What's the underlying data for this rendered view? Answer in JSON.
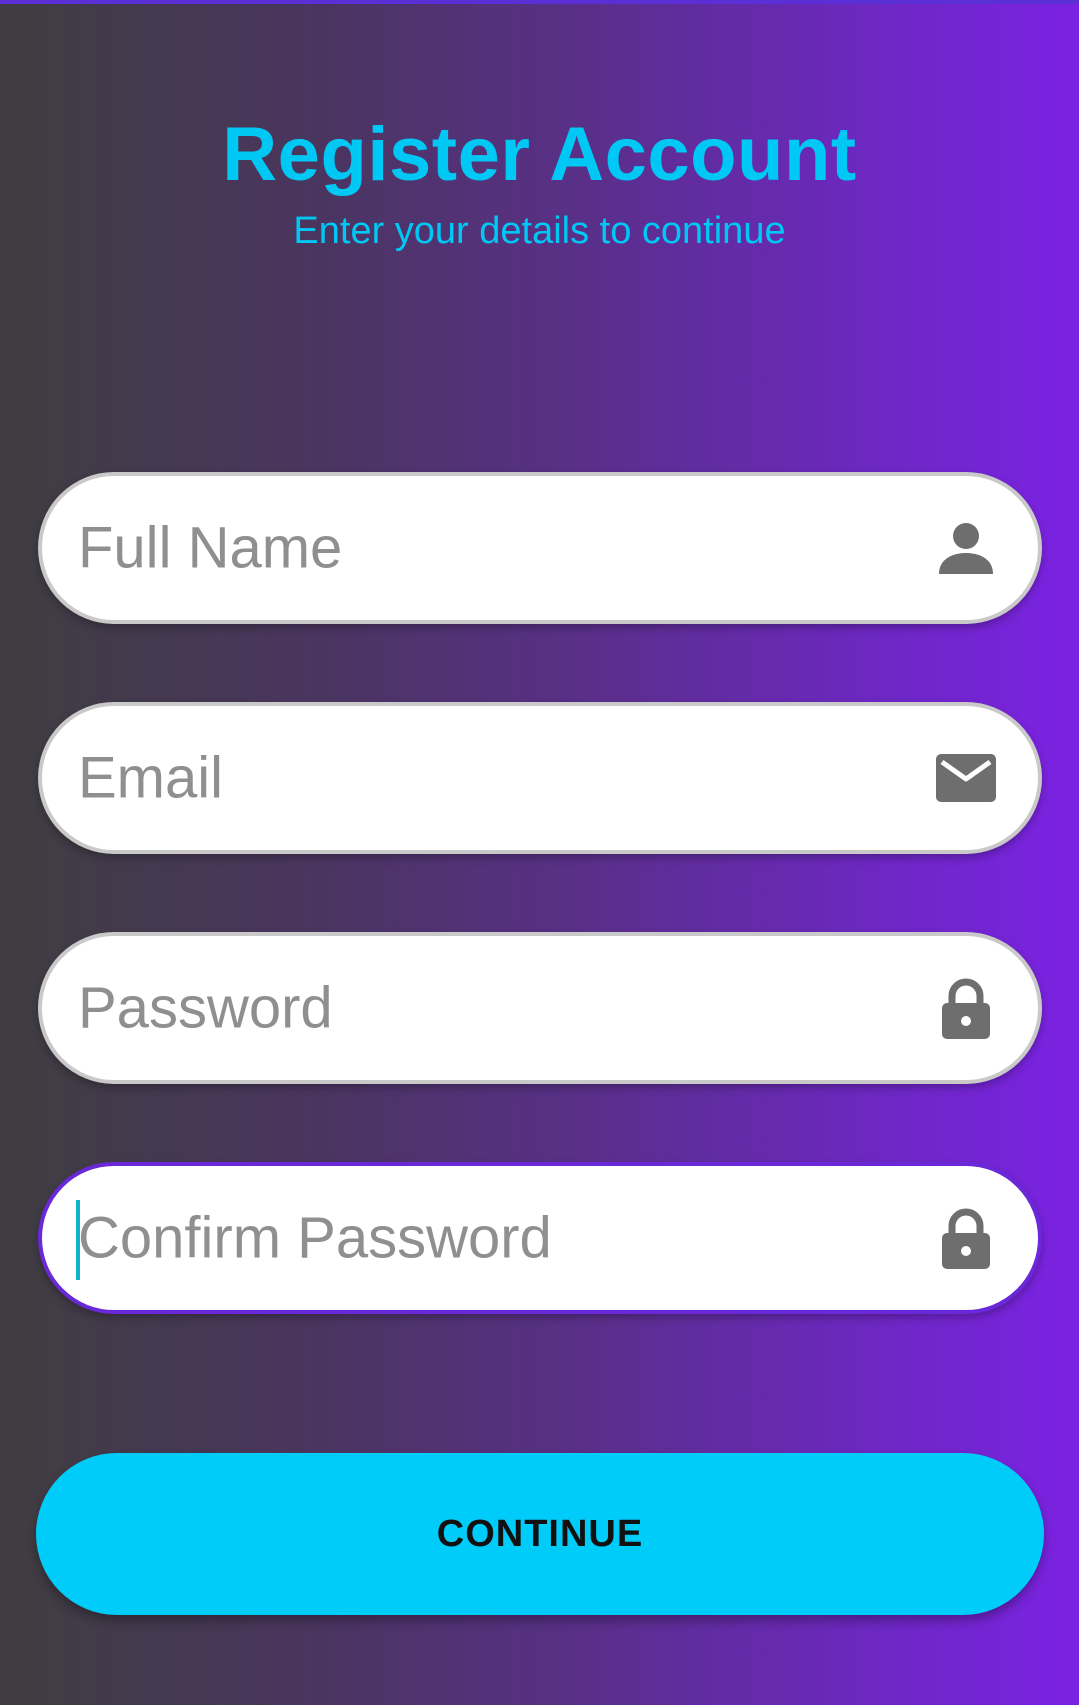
{
  "header": {
    "title": "Register Account",
    "subtitle": "Enter your details to continue"
  },
  "form": {
    "fields": [
      {
        "placeholder": "Full Name",
        "icon": "person-icon",
        "value": ""
      },
      {
        "placeholder": "Email",
        "icon": "envelope-icon",
        "value": ""
      },
      {
        "placeholder": "Password",
        "icon": "lock-icon",
        "value": ""
      },
      {
        "placeholder": "Confirm Password",
        "icon": "lock-icon",
        "value": "",
        "focused": true
      }
    ],
    "continue_label": "CONTINUE"
  },
  "colors": {
    "accent": "#00c8f5",
    "button": "#00ccf9",
    "icon": "#6e6e6e",
    "placeholder": "#8f8f8f",
    "gradient_start": "#3f3d40",
    "gradient_end": "#7b22e3",
    "focus_border": "#6a28d8",
    "cursor": "#11b3c9"
  }
}
